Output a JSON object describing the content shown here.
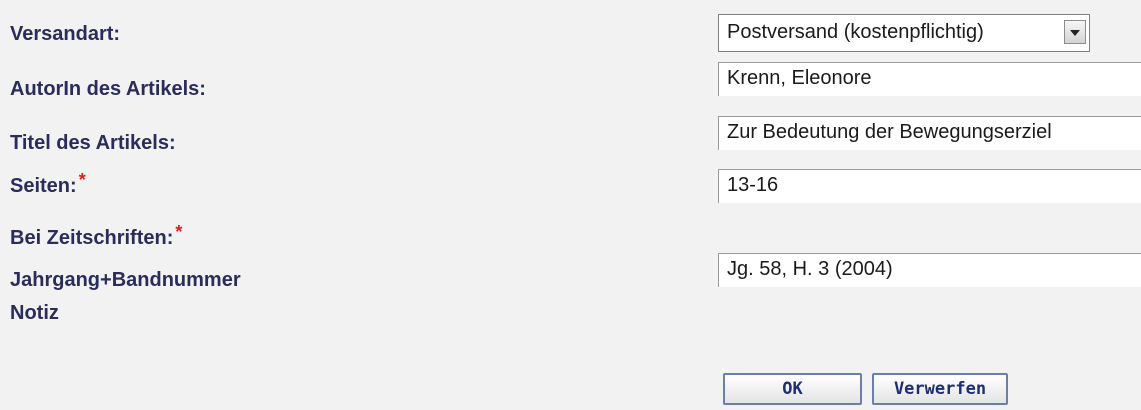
{
  "form": {
    "versandart_label": "Versandart:",
    "versandart_value": "Postversand (kostenpflichtig)",
    "autorin_label": "AutorIn des Artikels:",
    "autorin_value": "Krenn, Eleonore",
    "titel_label": "Titel des Artikels:",
    "titel_value": "Zur Bedeutung der Bewegungserziel",
    "seiten_label": "Seiten:",
    "seiten_value": "13-16",
    "zeitschriften_label": "Bei Zeitschriften:",
    "jahrgang_label": "Jahrgang+Bandnummer",
    "jahrgang_value": "Jg. 58, H. 3 (2004)",
    "notiz_label": "Notiz",
    "required_mark": "*"
  },
  "buttons": {
    "ok_label": "OK",
    "discard_label": "Verwerfen"
  }
}
